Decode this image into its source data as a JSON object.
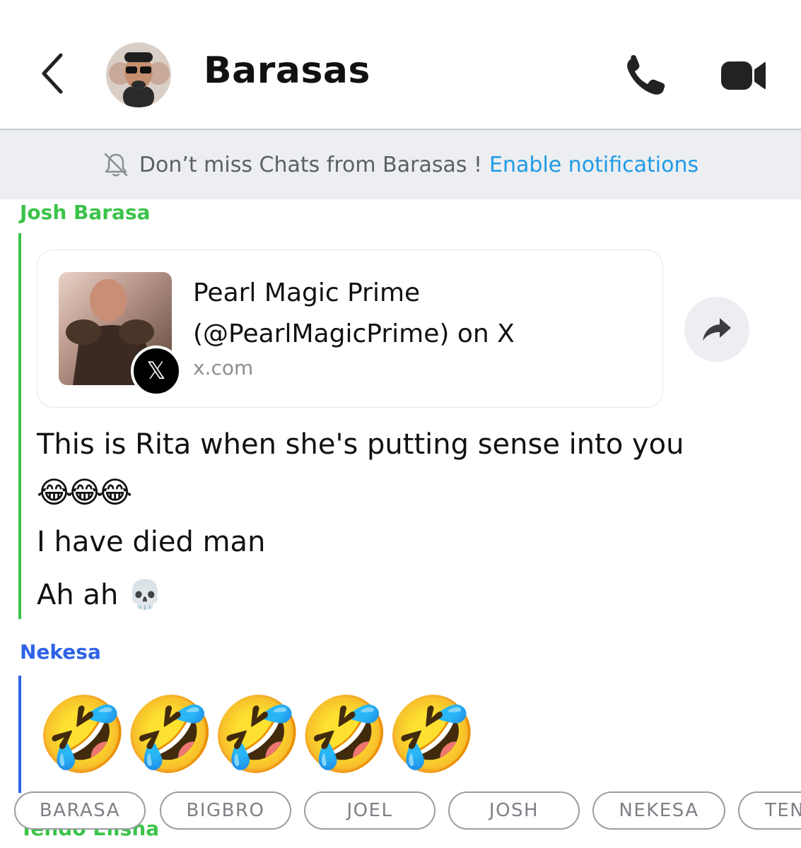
{
  "header": {
    "title": "Barasas",
    "back_icon": "chevron-left-icon",
    "call_icon": "phone-icon",
    "video_icon": "video-camera-icon"
  },
  "notice": {
    "text": "Don’t miss Chats from Barasas !",
    "link": "Enable notifications",
    "icon": "bell-off-icon"
  },
  "messages": {
    "josh": {
      "sender": "Josh Barasa",
      "color": "#3cc34a",
      "link_card": {
        "title": "Pearl Magic Prime (@PearlMagicPrime) on X",
        "domain": "x.com",
        "badge": "𝕏"
      },
      "lines": [
        "This is Rita when she's putting sense into you",
        "😂😂😂",
        "I have died man",
        "Ah ah 💀"
      ]
    },
    "nekesa": {
      "sender": "Nekesa",
      "color": "#2f63e6",
      "lines": [
        "🤣🤣🤣🤣🤣"
      ]
    },
    "next_sender": "Tendo Elisha"
  },
  "mention_chips": [
    "BARASA",
    "BIGBRO",
    "JOEL",
    "JOSH",
    "NEKESA",
    "TEN"
  ],
  "colors": {
    "accent_link": "#1e9be6",
    "notice_bg": "#eceef1"
  }
}
